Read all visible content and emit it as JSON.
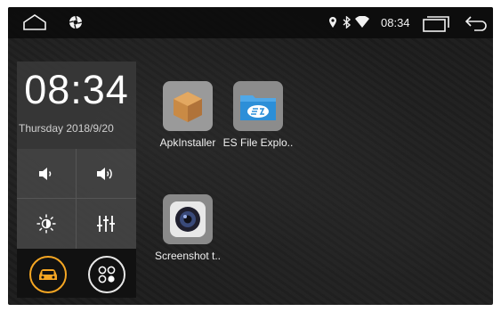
{
  "status_bar": {
    "time": "08:34",
    "icons": [
      "home-icon",
      "settings-icon",
      "location-icon",
      "bluetooth-icon",
      "wifi-icon",
      "recent-apps-icon",
      "back-icon"
    ]
  },
  "clock_widget": {
    "time": "08:34",
    "date": "Thursday 2018/9/20"
  },
  "controls": [
    "volume-down-icon",
    "volume-up-icon",
    "brightness-icon",
    "equalizer-icon",
    "car-icon",
    "apps-icon"
  ],
  "colors": {
    "accent": "#f5a623",
    "background": "#1d1d1d"
  },
  "apps": [
    {
      "label": "ApkInstaller",
      "icon": "package-icon"
    },
    {
      "label": "ES File Explo..",
      "icon": "es-file-explorer-icon"
    },
    {
      "label": "Screenshot t..",
      "icon": "camera-icon"
    }
  ]
}
